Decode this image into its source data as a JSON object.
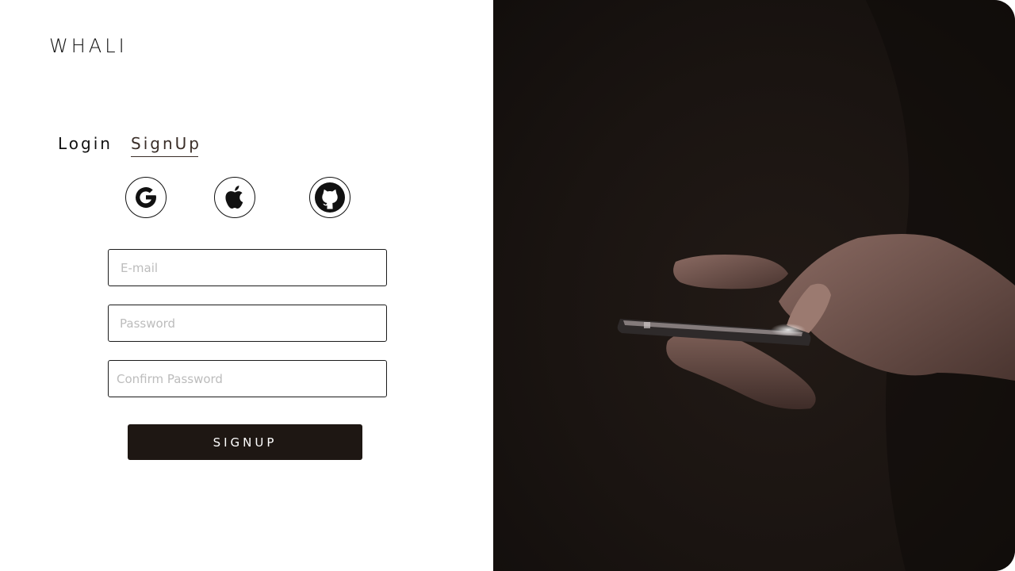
{
  "brand": {
    "name": "WHALI"
  },
  "tabs": {
    "login": "Login",
    "signup": "SignUp",
    "active": "signup"
  },
  "social": [
    {
      "provider": "google",
      "icon": "google-icon"
    },
    {
      "provider": "apple",
      "icon": "apple-icon"
    },
    {
      "provider": "github",
      "icon": "github-icon"
    }
  ],
  "form": {
    "email": {
      "value": "",
      "placeholder": "E-mail"
    },
    "password": {
      "value": "",
      "placeholder": "Password"
    },
    "confirm_password": {
      "value": "",
      "placeholder": "Confirm Password"
    },
    "submit_label": "SIGNUP"
  },
  "colors": {
    "accent": "#1e1713",
    "hero_background": "#1a1411",
    "field_border": "#1b1b1b",
    "placeholder": "#bcbcbc"
  }
}
